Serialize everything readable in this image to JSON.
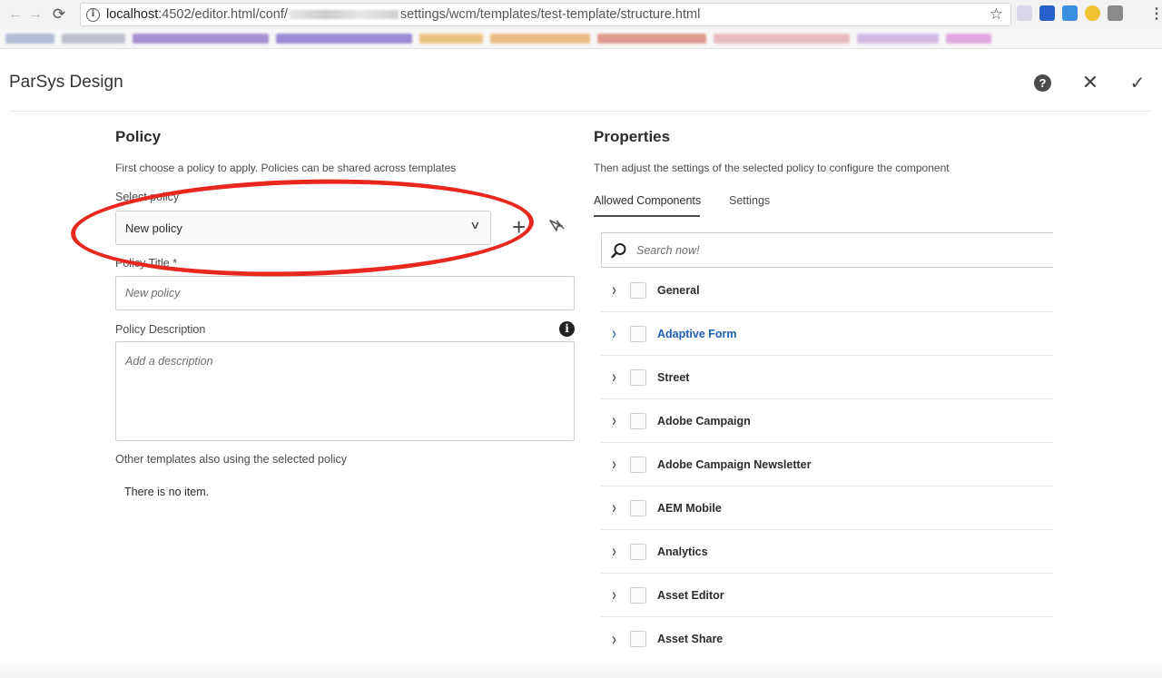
{
  "browser": {
    "url_host": "localhost",
    "url_path_start": ":4502/editor.html/conf/",
    "url_path_end": "settings/wcm/templates/test-template/structure.html",
    "nav_back_icon": "arrow-left-icon",
    "nav_forward_icon": "arrow-right-icon",
    "reload_icon": "reload-icon"
  },
  "dialog": {
    "title": "ParSys Design",
    "help_glyph": "?",
    "close_glyph": "✕",
    "confirm_glyph": "✓"
  },
  "policy": {
    "heading": "Policy",
    "description": "First choose a policy to apply. Policies can be shared across templates",
    "select_label": "Select policy",
    "select_value": "New policy",
    "title_label": "Policy Title *",
    "title_placeholder": "New policy",
    "desc_label": "Policy Description",
    "desc_placeholder": "Add a description",
    "other_templates_label": "Other templates also using the selected policy",
    "no_item_text": "There is no item."
  },
  "properties": {
    "heading": "Properties",
    "description": "Then adjust the settings of the selected policy to configure the component",
    "tabs": [
      {
        "label": "Allowed Components",
        "active": true
      },
      {
        "label": "Settings",
        "active": false
      }
    ],
    "search_placeholder": "Search now!",
    "components": [
      {
        "label": "General"
      },
      {
        "label": "Adaptive Form"
      },
      {
        "label": "Street"
      },
      {
        "label": "Adobe Campaign"
      },
      {
        "label": "Adobe Campaign Newsletter"
      },
      {
        "label": "AEM Mobile"
      },
      {
        "label": "Analytics"
      },
      {
        "label": "Asset Editor"
      },
      {
        "label": "Asset Share"
      }
    ]
  },
  "colors": {
    "annotation": "#e8281e",
    "highlight_text": "#1f5fb8"
  }
}
